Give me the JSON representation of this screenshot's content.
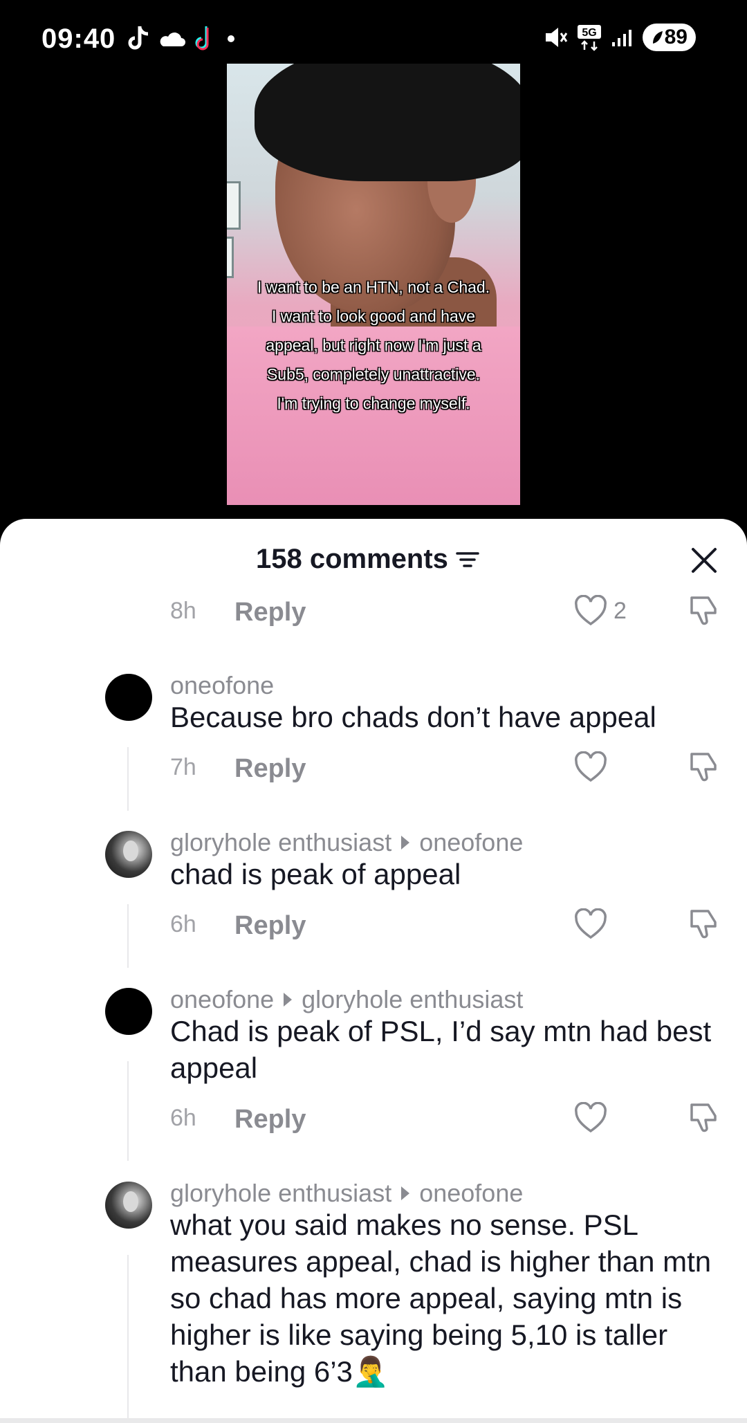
{
  "status_bar": {
    "time": "09:40",
    "network": "5G",
    "battery": "89"
  },
  "video": {
    "caption_lines": [
      "I want to be an HTN, not a Chad.",
      "I want to look good and have",
      "appeal, but right now I'm just a",
      "Sub5, completely unattractive.",
      "I'm trying to change myself."
    ]
  },
  "comments_panel": {
    "title": "158 comments",
    "top_row": {
      "time": "8h",
      "reply": "Reply",
      "like_count": "2"
    },
    "comments": [
      {
        "username": "oneofone",
        "reply_to": "",
        "text": "Because bro chads don’t have appeal",
        "time": "7h",
        "reply": "Reply"
      },
      {
        "username": "gloryhole enthusiast",
        "reply_to": "oneofone",
        "text": "chad is peak of appeal",
        "time": "6h",
        "reply": "Reply"
      },
      {
        "username": "oneofone",
        "reply_to": "gloryhole enthusiast",
        "text": "Chad is peak of PSL, I’d say mtn had best appeal",
        "time": "6h",
        "reply": "Reply"
      },
      {
        "username": "gloryhole enthusiast",
        "reply_to": "oneofone",
        "text": "what you said makes no sense. PSL measures appeal, chad is higher than mtn so chad has more appeal, saying mtn is higher is like saying being 5,10 is taller than being 6’3🤦‍♂️"
      }
    ]
  }
}
